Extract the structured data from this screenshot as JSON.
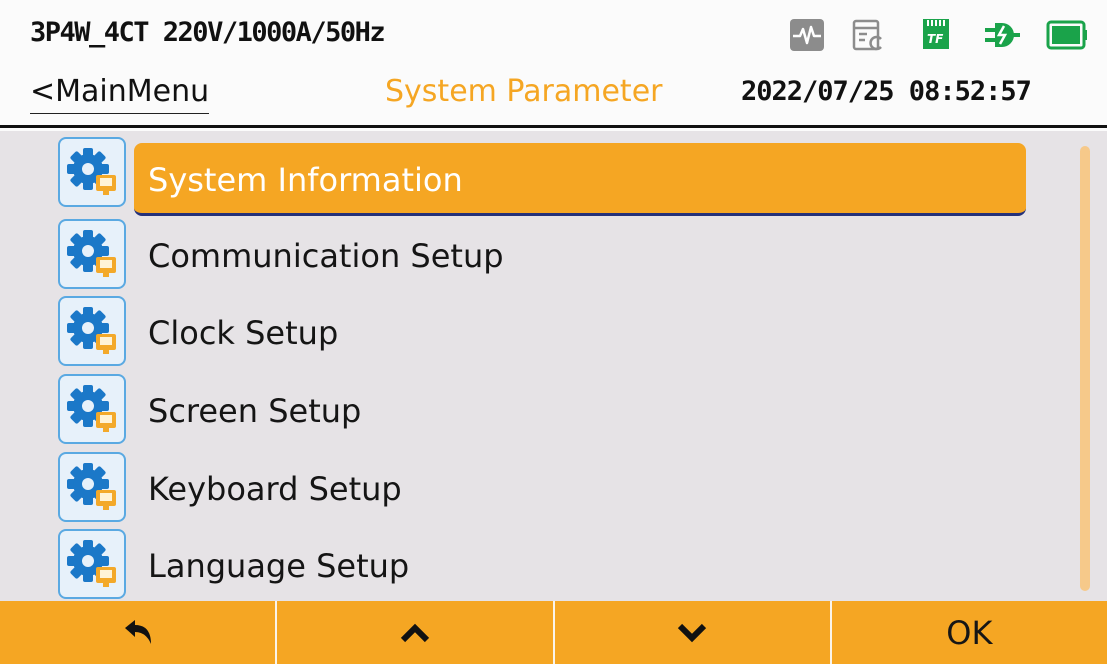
{
  "status": {
    "wiring_info": "3P4W_4CT 220V/1000A/50Hz",
    "icons": [
      "waveform-icon",
      "log-icon",
      "tf-card-icon",
      "power-plug-icon",
      "battery-icon"
    ],
    "tf_label": "TF"
  },
  "header": {
    "back_label": "<MainMenu",
    "title": "System Parameter",
    "datetime": "2022/07/25 08:52:57"
  },
  "menu": {
    "items": [
      {
        "label": "System Information",
        "icon": "settings-gear-icon",
        "selected": true
      },
      {
        "label": "Communication Setup",
        "icon": "settings-gear-icon",
        "selected": false
      },
      {
        "label": "Clock Setup",
        "icon": "settings-gear-icon",
        "selected": false
      },
      {
        "label": "Screen Setup",
        "icon": "settings-gear-icon",
        "selected": false
      },
      {
        "label": "Keyboard Setup",
        "icon": "settings-gear-icon",
        "selected": false
      },
      {
        "label": "Language Setup",
        "icon": "settings-gear-icon",
        "selected": false
      }
    ]
  },
  "softkeys": {
    "back_icon": "return-arrow-icon",
    "up_icon": "chevron-up-icon",
    "down_icon": "chevron-down-icon",
    "ok_label": "OK"
  },
  "colors": {
    "accent": "#f5a623",
    "title": "#f5a623",
    "list_bg": "#e6e3e6",
    "icon_blue": "#5aa9e2",
    "tf_green": "#1aa34a"
  }
}
